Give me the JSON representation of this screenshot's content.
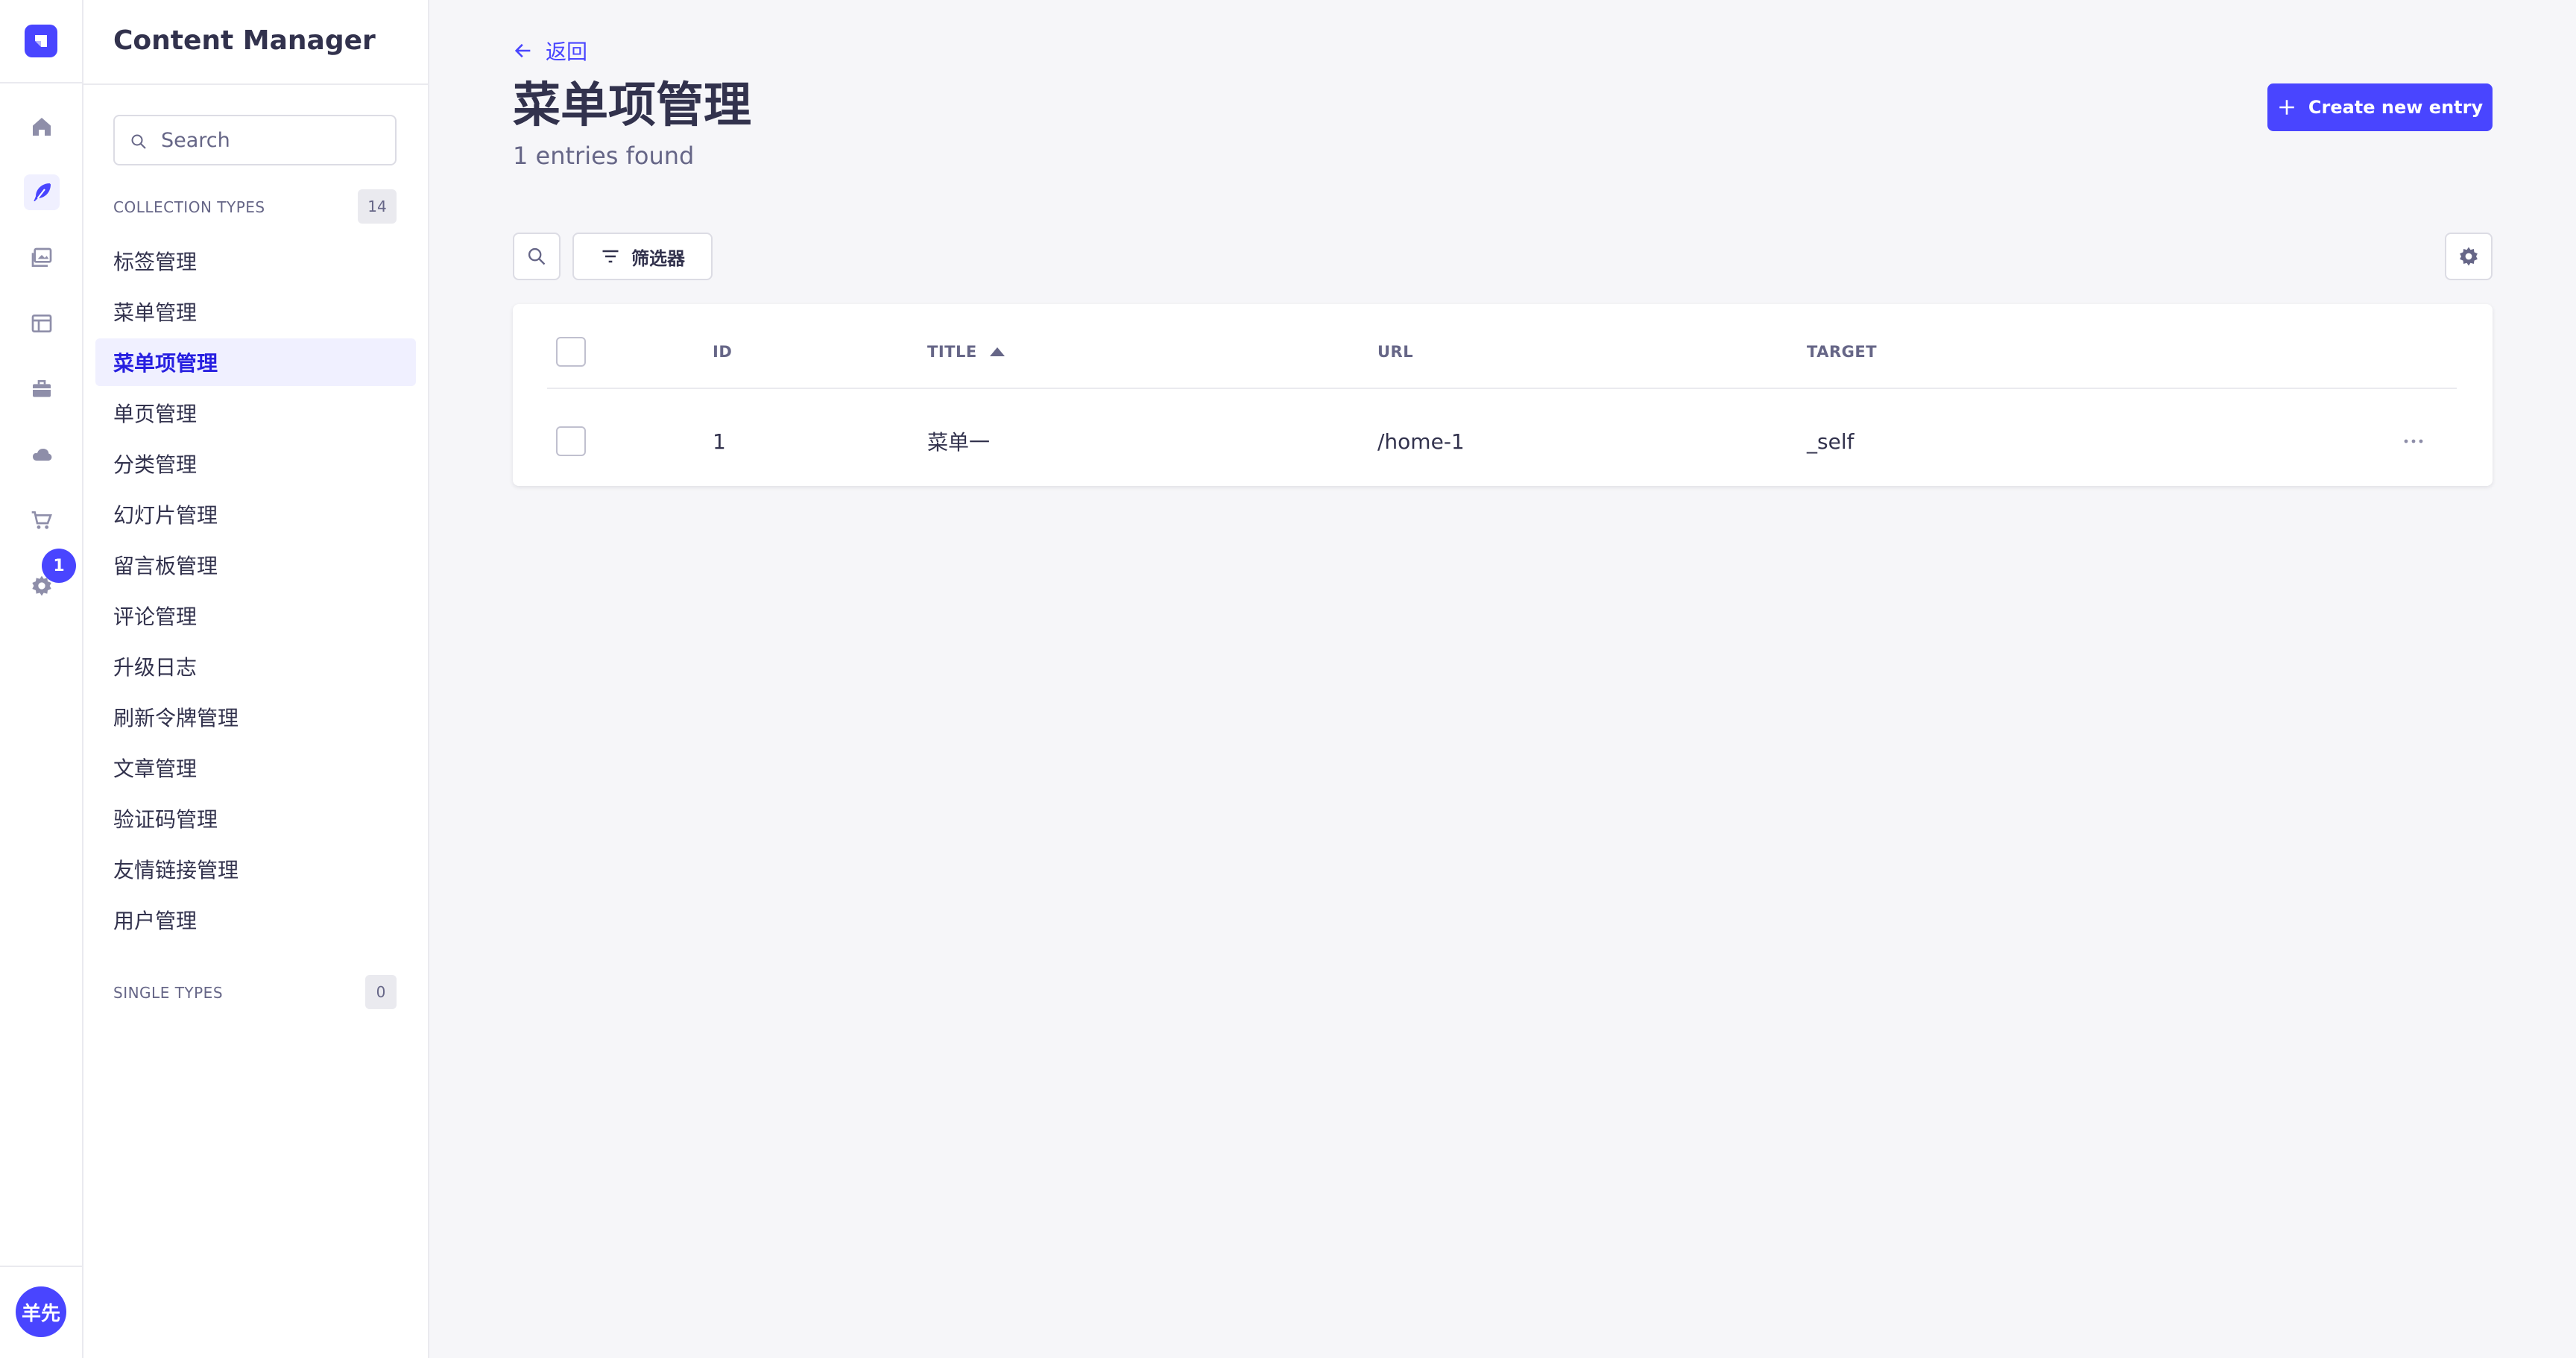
{
  "rail": {
    "notification_count": "1",
    "avatar_initials": "羊先",
    "items": [
      {
        "icon": "home-icon"
      },
      {
        "icon": "feather-icon",
        "active": true
      },
      {
        "icon": "media-library-icon"
      },
      {
        "icon": "layout-icon"
      },
      {
        "icon": "briefcase-icon"
      },
      {
        "icon": "cloud-icon"
      },
      {
        "icon": "cart-icon"
      },
      {
        "icon": "gear-icon"
      }
    ]
  },
  "sidebar": {
    "title": "Content Manager",
    "search_placeholder": "Search",
    "collection_types_label": "COLLECTION TYPES",
    "collection_types_count": "14",
    "items": [
      {
        "label": "标签管理"
      },
      {
        "label": "菜单管理"
      },
      {
        "label": "菜单项管理",
        "active": true
      },
      {
        "label": "单页管理"
      },
      {
        "label": "分类管理"
      },
      {
        "label": "幻灯片管理"
      },
      {
        "label": "留言板管理"
      },
      {
        "label": "评论管理"
      },
      {
        "label": "升级日志"
      },
      {
        "label": "刷新令牌管理"
      },
      {
        "label": "文章管理"
      },
      {
        "label": "验证码管理"
      },
      {
        "label": "友情链接管理"
      },
      {
        "label": "用户管理"
      }
    ],
    "single_types_label": "SINGLE TYPES",
    "single_types_count": "0"
  },
  "header": {
    "back_label": "返回",
    "title": "菜单项管理",
    "subtitle": "1 entries found",
    "create_label": "Create new entry"
  },
  "toolbar": {
    "filter_label": "筛选器"
  },
  "table": {
    "columns": [
      "ID",
      "TITLE",
      "URL",
      "TARGET"
    ],
    "sorted_column": "TITLE",
    "sort_direction": "asc",
    "rows": [
      {
        "id": "1",
        "title": "菜单一",
        "url": "/home-1",
        "target": "_self"
      }
    ]
  },
  "colors": {
    "primary": "#4945ff",
    "primary_light": "#f0f0ff",
    "text": "#32324d",
    "muted": "#666687",
    "background": "#f6f6f9"
  }
}
